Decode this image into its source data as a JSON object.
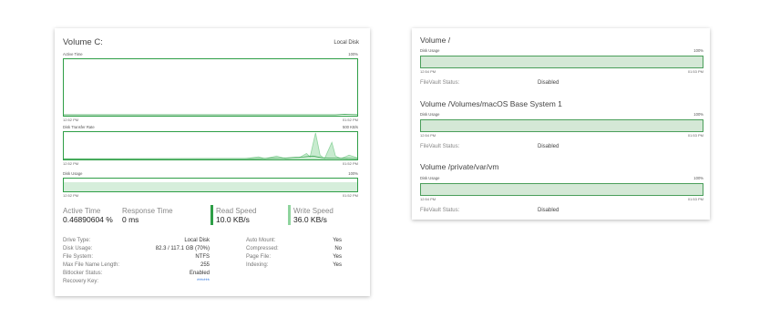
{
  "left": {
    "title": "Volume C:",
    "type_label": "Local Disk",
    "graphs": [
      {
        "label": "Active Time",
        "max": "100%",
        "start": "12:52 PM",
        "end": "01:52 PM"
      },
      {
        "label": "Disk Transfer Rate",
        "max": "500 KB/s",
        "start": "12:52 PM",
        "end": "01:52 PM"
      },
      {
        "label": "Disk Usage",
        "max": "100%",
        "start": "12:52 PM",
        "end": "01:52 PM"
      }
    ],
    "metrics": {
      "active_time": {
        "label": "Active Time",
        "value": "0.46890604 %"
      },
      "response_time": {
        "label": "Response Time",
        "value": "0 ms"
      },
      "read_speed": {
        "label": "Read Speed",
        "value": "10.0 KB/s",
        "color": "#2e9e46"
      },
      "write_speed": {
        "label": "Write Speed",
        "value": "36.0 KB/s",
        "color": "#8fd49e"
      }
    },
    "props_left": [
      {
        "key": "Drive Type:",
        "value": "Local Disk"
      },
      {
        "key": "Disk Usage:",
        "value": "82.3 / 117.1 GB (70%)"
      },
      {
        "key": "File System:",
        "value": "NTFS"
      },
      {
        "key": "Max File Name Length:",
        "value": "255"
      },
      {
        "key": "Bitlocker Status:",
        "value": "Enabled"
      },
      {
        "key": "Recovery Key:",
        "value": "******"
      }
    ],
    "props_right": [
      {
        "key": "Auto Mount:",
        "value": "Yes"
      },
      {
        "key": "Compressed:",
        "value": "No"
      },
      {
        "key": "Page File:",
        "value": "Yes"
      },
      {
        "key": "Indexing:",
        "value": "Yes"
      }
    ]
  },
  "right": {
    "volumes": [
      {
        "title": "Volume /",
        "usage_label": "Disk Usage",
        "max": "100%",
        "start": "12:54 PM",
        "end": "01:53 PM",
        "fv_label": "FileVault Status:",
        "fv_value": "Disabled"
      },
      {
        "title": "Volume /Volumes/macOS Base System 1",
        "usage_label": "Disk Usage",
        "max": "100%",
        "start": "12:54 PM",
        "end": "01:53 PM",
        "fv_label": "FileVault Status:",
        "fv_value": "Disabled"
      },
      {
        "title": "Volume /private/var/vm",
        "usage_label": "Disk Usage",
        "max": "100%",
        "start": "12:54 PM",
        "end": "01:53 PM",
        "fv_label": "FileVault Status:",
        "fv_value": "Disabled"
      }
    ]
  },
  "colors": {
    "accent": "#2e9e46",
    "accent_light": "#8fd49e",
    "fill": "#d6eedb",
    "link": "#3a7ee0"
  }
}
